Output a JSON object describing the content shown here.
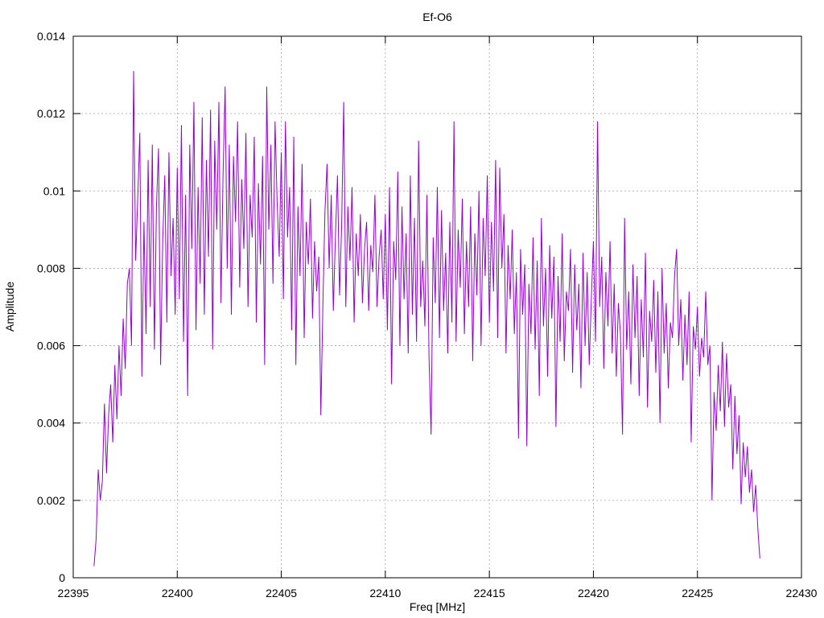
{
  "chart_data": {
    "type": "line",
    "title": "Ef-O6",
    "xlabel": "Freq [MHz]",
    "ylabel": "Amplitude",
    "xlim": [
      22395,
      22430
    ],
    "ylim": [
      0,
      0.014
    ],
    "xticks": [
      "22395",
      "22400",
      "22405",
      "22410",
      "22415",
      "22420",
      "22425",
      "22430"
    ],
    "yticks": [
      "0",
      "0.002",
      "0.004",
      "0.006",
      "0.008",
      "0.01",
      "0.012",
      "0.014"
    ],
    "grid": true,
    "series": [
      {
        "color": "#9400d3",
        "x": [
          22396,
          22396.1,
          22396.2,
          22396.3,
          22396.4,
          22396.5,
          22396.6,
          22396.7,
          22396.8,
          22396.9,
          22397,
          22397.1,
          22397.2,
          22397.3,
          22397.4,
          22397.5,
          22397.6,
          22397.7,
          22397.8,
          22397.9,
          22398,
          22398.1,
          22398.2,
          22398.3,
          22398.4,
          22398.5,
          22398.6,
          22398.7,
          22398.8,
          22398.9,
          22399,
          22399.1,
          22399.2,
          22399.3,
          22399.4,
          22399.5,
          22399.6,
          22399.7,
          22399.8,
          22399.9,
          22400,
          22400.1,
          22400.2,
          22400.3,
          22400.4,
          22400.5,
          22400.6,
          22400.7,
          22400.8,
          22400.9,
          22401,
          22401.1,
          22401.2,
          22401.3,
          22401.4,
          22401.5,
          22401.6,
          22401.7,
          22401.8,
          22401.9,
          22402,
          22402.1,
          22402.2,
          22402.3,
          22402.4,
          22402.5,
          22402.6,
          22402.7,
          22402.8,
          22402.9,
          22403,
          22403.1,
          22403.2,
          22403.3,
          22403.4,
          22403.5,
          22403.6,
          22403.7,
          22403.8,
          22403.9,
          22404,
          22404.1,
          22404.2,
          22404.3,
          22404.4,
          22404.5,
          22404.6,
          22404.7,
          22404.8,
          22404.9,
          22405,
          22405.1,
          22405.2,
          22405.3,
          22405.4,
          22405.5,
          22405.6,
          22405.7,
          22405.8,
          22405.9,
          22406,
          22406.1,
          22406.2,
          22406.3,
          22406.4,
          22406.5,
          22406.6,
          22406.7,
          22406.8,
          22406.9,
          22407,
          22407.1,
          22407.2,
          22407.3,
          22407.4,
          22407.5,
          22407.6,
          22407.7,
          22407.8,
          22407.9,
          22408,
          22408.1,
          22408.2,
          22408.3,
          22408.4,
          22408.5,
          22408.6,
          22408.7,
          22408.8,
          22408.9,
          22409,
          22409.1,
          22409.2,
          22409.3,
          22409.4,
          22409.5,
          22409.6,
          22409.7,
          22409.8,
          22409.9,
          22410,
          22410.1,
          22410.2,
          22410.3,
          22410.4,
          22410.5,
          22410.6,
          22410.7,
          22410.8,
          22410.9,
          22411,
          22411.1,
          22411.2,
          22411.3,
          22411.4,
          22411.5,
          22411.6,
          22411.7,
          22411.8,
          22411.9,
          22412,
          22412.1,
          22412.2,
          22412.3,
          22412.4,
          22412.5,
          22412.6,
          22412.7,
          22412.8,
          22412.9,
          22413,
          22413.1,
          22413.2,
          22413.3,
          22413.4,
          22413.5,
          22413.6,
          22413.7,
          22413.8,
          22413.9,
          22414,
          22414.1,
          22414.2,
          22414.3,
          22414.4,
          22414.5,
          22414.6,
          22414.7,
          22414.8,
          22414.9,
          22415,
          22415.1,
          22415.2,
          22415.3,
          22415.4,
          22415.5,
          22415.6,
          22415.7,
          22415.8,
          22415.9,
          22416,
          22416.1,
          22416.2,
          22416.3,
          22416.4,
          22416.5,
          22416.6,
          22416.7,
          22416.8,
          22416.9,
          22417,
          22417.1,
          22417.2,
          22417.3,
          22417.4,
          22417.5,
          22417.6,
          22417.7,
          22417.8,
          22417.9,
          22418,
          22418.1,
          22418.2,
          22418.3,
          22418.4,
          22418.5,
          22418.6,
          22418.7,
          22418.8,
          22418.9,
          22419,
          22419.1,
          22419.2,
          22419.3,
          22419.4,
          22419.5,
          22419.6,
          22419.7,
          22419.8,
          22419.9,
          22420,
          22420.1,
          22420.2,
          22420.3,
          22420.4,
          22420.5,
          22420.6,
          22420.7,
          22420.8,
          22420.9,
          22421,
          22421.1,
          22421.2,
          22421.3,
          22421.4,
          22421.5,
          22421.6,
          22421.7,
          22421.8,
          22421.9,
          22422,
          22422.1,
          22422.2,
          22422.3,
          22422.4,
          22422.5,
          22422.6,
          22422.7,
          22422.8,
          22422.9,
          22423,
          22423.1,
          22423.2,
          22423.3,
          22423.4,
          22423.5,
          22423.6,
          22423.7,
          22423.8,
          22423.9,
          22424,
          22424.1,
          22424.2,
          22424.3,
          22424.4,
          22424.5,
          22424.6,
          22424.7,
          22424.8,
          22424.9,
          22425,
          22425.1,
          22425.2,
          22425.3,
          22425.4,
          22425.5,
          22425.6,
          22425.7,
          22425.8,
          22425.9,
          22426,
          22426.1,
          22426.2,
          22426.3,
          22426.4,
          22426.5,
          22426.6,
          22426.7,
          22426.8,
          22426.9,
          22427,
          22427.1,
          22427.2,
          22427.3,
          22427.4,
          22427.5,
          22427.6,
          22427.7,
          22427.8,
          22427.9,
          22428
        ],
        "y": [
          0.0003,
          0.001,
          0.0028,
          0.002,
          0.0025,
          0.0045,
          0.0027,
          0.0042,
          0.005,
          0.0035,
          0.0055,
          0.0041,
          0.006,
          0.0047,
          0.0067,
          0.0054,
          0.0076,
          0.008,
          0.006,
          0.0131,
          0.0082,
          0.0098,
          0.0115,
          0.0052,
          0.0092,
          0.0063,
          0.0108,
          0.007,
          0.0112,
          0.0059,
          0.0096,
          0.0111,
          0.0055,
          0.0087,
          0.0104,
          0.0066,
          0.011,
          0.0078,
          0.0093,
          0.0068,
          0.0106,
          0.0072,
          0.0117,
          0.0061,
          0.0099,
          0.0047,
          0.0112,
          0.0085,
          0.0123,
          0.0064,
          0.0101,
          0.0076,
          0.0119,
          0.0068,
          0.0108,
          0.0083,
          0.0121,
          0.0059,
          0.0113,
          0.009,
          0.0123,
          0.0071,
          0.0104,
          0.0127,
          0.008,
          0.0112,
          0.0068,
          0.0109,
          0.0092,
          0.0118,
          0.0075,
          0.0103,
          0.0085,
          0.0115,
          0.007,
          0.0099,
          0.0088,
          0.0114,
          0.0066,
          0.0102,
          0.0081,
          0.0109,
          0.0055,
          0.0127,
          0.009,
          0.0112,
          0.0076,
          0.0118,
          0.0097,
          0.0083,
          0.011,
          0.0072,
          0.0118,
          0.0088,
          0.0101,
          0.0064,
          0.0114,
          0.0055,
          0.0096,
          0.0078,
          0.0107,
          0.0062,
          0.0092,
          0.0081,
          0.0098,
          0.0067,
          0.0087,
          0.0074,
          0.0083,
          0.0042,
          0.0071,
          0.0095,
          0.0107,
          0.008,
          0.0099,
          0.0069,
          0.0088,
          0.0104,
          0.0073,
          0.0091,
          0.0123,
          0.007,
          0.0096,
          0.0082,
          0.0101,
          0.0066,
          0.0089,
          0.0078,
          0.0094,
          0.0071,
          0.0085,
          0.0092,
          0.0069,
          0.0086,
          0.0079,
          0.0099,
          0.007,
          0.0083,
          0.009,
          0.0072,
          0.0094,
          0.0064,
          0.0101,
          0.005,
          0.0087,
          0.0077,
          0.0105,
          0.006,
          0.0096,
          0.0072,
          0.0089,
          0.0058,
          0.0104,
          0.0068,
          0.0093,
          0.0061,
          0.0113,
          0.007,
          0.0082,
          0.0065,
          0.0099,
          0.0057,
          0.0037,
          0.0088,
          0.0071,
          0.0101,
          0.0062,
          0.0095,
          0.0069,
          0.0084,
          0.0058,
          0.0092,
          0.0066,
          0.0118,
          0.0061,
          0.009,
          0.0075,
          0.0098,
          0.0063,
          0.0087,
          0.007,
          0.0096,
          0.0056,
          0.0089,
          0.0073,
          0.01,
          0.006,
          0.0093,
          0.0078,
          0.0104,
          0.0066,
          0.0092,
          0.0074,
          0.0108,
          0.0062,
          0.0106,
          0.008,
          0.0094,
          0.0058,
          0.0086,
          0.0072,
          0.009,
          0.0063,
          0.0079,
          0.0036,
          0.0085,
          0.0068,
          0.0081,
          0.0034,
          0.0076,
          0.0063,
          0.0088,
          0.0059,
          0.0082,
          0.0047,
          0.0093,
          0.0065,
          0.008,
          0.0052,
          0.0086,
          0.0067,
          0.0083,
          0.0039,
          0.0078,
          0.0061,
          0.0089,
          0.0056,
          0.0074,
          0.0069,
          0.0085,
          0.0053,
          0.0081,
          0.0064,
          0.0076,
          0.0049,
          0.0084,
          0.006,
          0.0079,
          0.0055,
          0.0072,
          0.0087,
          0.0061,
          0.0118,
          0.007,
          0.0083,
          0.0054,
          0.0079,
          0.0065,
          0.0087,
          0.0058,
          0.0076,
          0.0052,
          0.0071,
          0.0063,
          0.0037,
          0.0093,
          0.0059,
          0.0074,
          0.005,
          0.0081,
          0.0062,
          0.0078,
          0.0047,
          0.0072,
          0.0057,
          0.0084,
          0.0044,
          0.0069,
          0.0061,
          0.0077,
          0.0053,
          0.0074,
          0.004,
          0.008,
          0.0058,
          0.0071,
          0.0049,
          0.0066,
          0.0062,
          0.0078,
          0.0085,
          0.006,
          0.0072,
          0.0051,
          0.0068,
          0.0055,
          0.0074,
          0.0035,
          0.0065,
          0.0059,
          0.007,
          0.0052,
          0.0062,
          0.0057,
          0.0074,
          0.0055,
          0.006,
          0.002,
          0.0048,
          0.0038,
          0.0055,
          0.0043,
          0.0061,
          0.0039,
          0.0058,
          0.0044,
          0.005,
          0.0028,
          0.0047,
          0.0032,
          0.0042,
          0.0019,
          0.0035,
          0.0026,
          0.0034,
          0.0022,
          0.0028,
          0.0017,
          0.0024,
          0.0013,
          0.0005
        ]
      }
    ]
  }
}
